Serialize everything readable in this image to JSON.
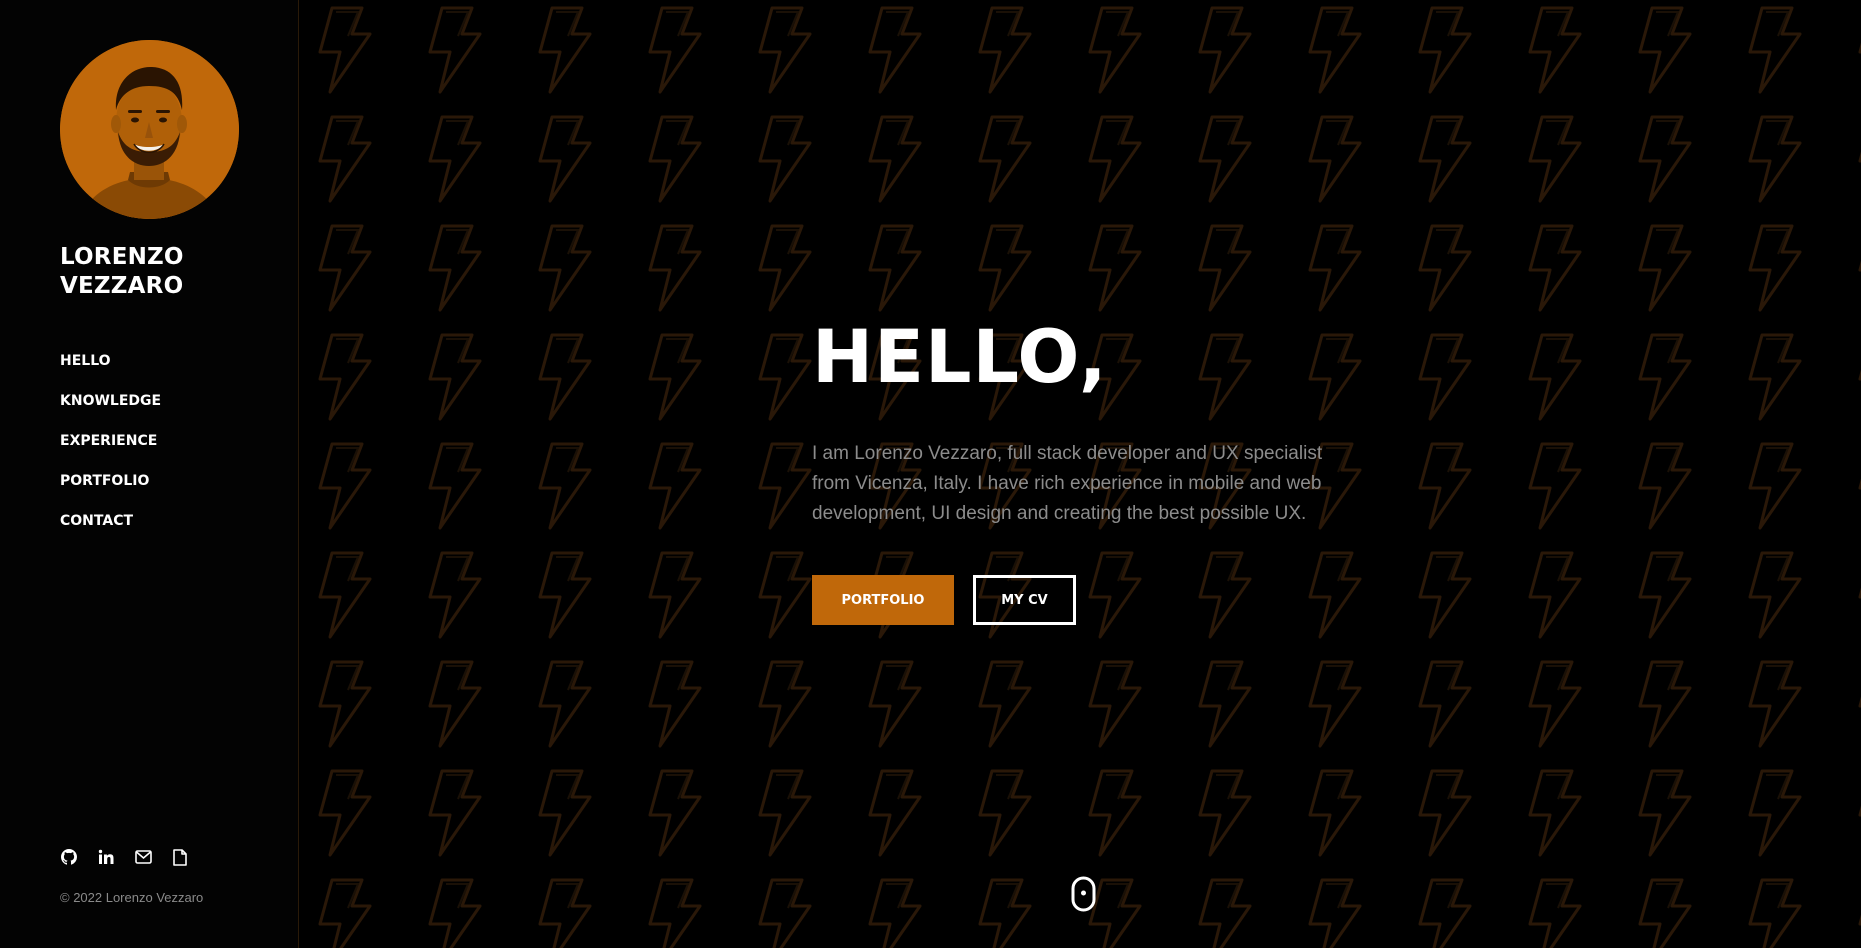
{
  "sidebar": {
    "name_line1": "LORENZO",
    "name_line2": "VEZZARO",
    "nav": [
      {
        "label": "HELLO",
        "active": true
      },
      {
        "label": "KNOWLEDGE",
        "active": false
      },
      {
        "label": "EXPERIENCE",
        "active": false
      },
      {
        "label": "PORTFOLIO",
        "active": false
      },
      {
        "label": "CONTACT",
        "active": false
      }
    ],
    "socials": [
      "github-icon",
      "linkedin-icon",
      "mail-icon",
      "document-icon"
    ],
    "copyright": "© 2022 Lorenzo Vezzaro"
  },
  "hero": {
    "title": "HELLO,",
    "intro": "I am Lorenzo Vezzaro, full stack developer and UX specialist from Vicenza, Italy. I have rich experience in mobile and web development, UI design and creating the best possible UX.",
    "primary_button": "PORTFOLIO",
    "secondary_button": "MY CV"
  },
  "icons": {
    "background_pattern": "lightning-bolt-icon",
    "scroll_indicator": "mouse-scroll-icon"
  },
  "colors": {
    "accent": "#c0680a",
    "background": "#000000",
    "text": "#ffffff",
    "muted_text": "#8c8c8c"
  }
}
